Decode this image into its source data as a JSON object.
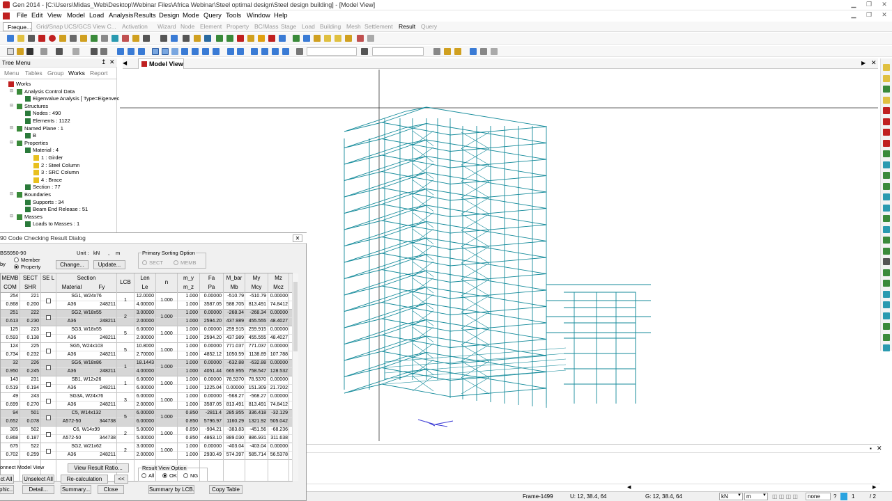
{
  "window": {
    "title": "Gen 2014 - [C:\\Users\\Midas_Web\\Desktop\\Webinar Files\\Africa Webinar\\Steel optimal design\\Steel design building] - [Model View]"
  },
  "menu": [
    "File",
    "Edit",
    "View",
    "Model",
    "Load",
    "Analysis",
    "Results",
    "Design",
    "Mode",
    "Query",
    "Tools",
    "Window",
    "Help"
  ],
  "ribbon": {
    "dropdown": "Freque...",
    "tabs": [
      {
        "label": "Grid/Snap",
        "active": false
      },
      {
        "label": "UCS/GCS",
        "active": false
      },
      {
        "label": "View C...",
        "active": false
      },
      {
        "label": "Activation",
        "active": false
      },
      {
        "label": "Wizard",
        "active": false
      },
      {
        "label": "Node",
        "active": false
      },
      {
        "label": "Element",
        "active": false
      },
      {
        "label": "Property",
        "active": false
      },
      {
        "label": "BC/Mass",
        "active": false
      },
      {
        "label": "Stage",
        "active": false
      },
      {
        "label": "Load",
        "active": false
      },
      {
        "label": "Building",
        "active": false
      },
      {
        "label": "Mesh",
        "active": false
      },
      {
        "label": "Settlement",
        "active": false
      },
      {
        "label": "Result",
        "active": true
      },
      {
        "label": "Query",
        "active": false
      }
    ]
  },
  "tree": {
    "title": "Tree Menu",
    "tabs": [
      "Menu",
      "Tables",
      "Group",
      "Works",
      "Report"
    ],
    "active_tab": "Works",
    "nodes": [
      {
        "label": "Works",
        "level": 0
      },
      {
        "label": "Analysis Control Data",
        "level": 1
      },
      {
        "label": "Eigenvalue Analysis [ Type=Eigenvec",
        "level": 2
      },
      {
        "label": "Structures",
        "level": 1
      },
      {
        "label": "Nodes : 490",
        "level": 2
      },
      {
        "label": "Elements : 1122",
        "level": 2
      },
      {
        "label": "Named Plane : 1",
        "level": 1
      },
      {
        "label": "B",
        "level": 2
      },
      {
        "label": "Properties",
        "level": 1
      },
      {
        "label": "Material : 4",
        "level": 2
      },
      {
        "label": "1 : Girder",
        "level": 3
      },
      {
        "label": "2 : Steel Column",
        "level": 3
      },
      {
        "label": "3 : SRC Column",
        "level": 3
      },
      {
        "label": "4 : Brace",
        "level": 3
      },
      {
        "label": "Section : 77",
        "level": 2
      },
      {
        "label": "Boundaries",
        "level": 1
      },
      {
        "label": "Supports : 34",
        "level": 2
      },
      {
        "label": "Beam End Release : 51",
        "level": 2
      },
      {
        "label": "Masses",
        "level": 1
      },
      {
        "label": "Loads to Masses : 1",
        "level": 2
      }
    ]
  },
  "model_view": {
    "tab_label": "Model View"
  },
  "dialog": {
    "title": "90 Code Checking Result Dialog",
    "code": "BS5950-90",
    "unit_label": "Unit :",
    "unit_force": "kN",
    "unit_sep": ",",
    "unit_length": "m",
    "sort_by_label": "by",
    "sort_member": "Member",
    "sort_property": "Property",
    "change_btn": "Change...",
    "update_btn": "Update...",
    "primary_sorting": {
      "title": "Primary Sorting Option",
      "sect": "SECT",
      "memb": "MEMB"
    },
    "headers_top": [
      "MEMB",
      "SECT",
      "SE L",
      "Section",
      "LCB",
      "Len",
      "n",
      "m_y",
      "Fa",
      "M_bar",
      "My",
      "Mz"
    ],
    "headers_bot": [
      "COM",
      "SHR",
      "",
      "Material",
      "Fy",
      "",
      "Le",
      "",
      "m_z",
      "Pa",
      "Mb",
      "Mcy",
      "Mcz"
    ],
    "rows": [
      {
        "memb": "254",
        "sect": "221",
        "section": "SG1, W24x76",
        "lcb": "1",
        "len": "12.0000",
        "n": "1.000",
        "my": "1.000",
        "fa": "0.00000",
        "mbar": "-510.79",
        "My": "-510.79",
        "Mz": "0.00000",
        "com": "0.868",
        "shr": "0.200",
        "mat": "A36",
        "fy": "248211",
        "le": "4.00000",
        "mz": "1.000",
        "pa": "3587.05",
        "mb": "588.705",
        "mcy": "813.491",
        "mcz": "74.8412",
        "shade": false
      },
      {
        "memb": "251",
        "sect": "222",
        "section": "SG2, W18x55",
        "lcb": "2",
        "len": "3.00000",
        "n": "1.000",
        "my": "1.000",
        "fa": "0.00000",
        "mbar": "-268.34",
        "My": "-268.34",
        "Mz": "0.00000",
        "com": "0.613",
        "shr": "0.230",
        "mat": "A36",
        "fy": "248211",
        "le": "2.00000",
        "mz": "1.000",
        "pa": "2594.20",
        "mb": "437.989",
        "mcy": "455.555",
        "mcz": "48.4027",
        "shade": true
      },
      {
        "memb": "125",
        "sect": "223",
        "section": "SG3, W18x55",
        "lcb": "5",
        "len": "6.00000",
        "n": "1.000",
        "my": "1.000",
        "fa": "0.00000",
        "mbar": "259.915",
        "My": "259.915",
        "Mz": "0.00000",
        "com": "0.593",
        "shr": "0.138",
        "mat": "A36",
        "fy": "248211",
        "le": "2.00000",
        "mz": "1.000",
        "pa": "2594.20",
        "mb": "437.989",
        "mcy": "455.555",
        "mcz": "48.4027",
        "shade": false
      },
      {
        "memb": "124",
        "sect": "225",
        "section": "SG5, W24x103",
        "lcb": "5",
        "len": "10.8000",
        "n": "1.000",
        "my": "1.000",
        "fa": "0.00000",
        "mbar": "771.037",
        "My": "771.037",
        "Mz": "0.00000",
        "com": "0.734",
        "shr": "0.232",
        "mat": "A36",
        "fy": "248211",
        "le": "2.70000",
        "mz": "1.000",
        "pa": "4852.12",
        "mb": "1050.59",
        "mcy": "1138.89",
        "mcz": "107.788",
        "shade": false
      },
      {
        "memb": "32",
        "sect": "226",
        "section": "SG6, W18x86",
        "lcb": "1",
        "len": "18.1443",
        "n": "1.000",
        "my": "1.000",
        "fa": "0.00000",
        "mbar": "-632.88",
        "My": "-632.88",
        "Mz": "0.00000",
        "com": "0.950",
        "shr": "0.245",
        "mat": "A36",
        "fy": "248211",
        "le": "4.00000",
        "mz": "1.000",
        "pa": "4051.44",
        "mb": "665.955",
        "mcy": "758.547",
        "mcz": "128.532",
        "shade": true
      },
      {
        "memb": "143",
        "sect": "231",
        "section": "SB1, W12x26",
        "lcb": "1",
        "len": "6.00000",
        "n": "1.000",
        "my": "1.000",
        "fa": "0.00000",
        "mbar": "78.5370",
        "My": "78.5370",
        "Mz": "0.00000",
        "com": "0.519",
        "shr": "0.194",
        "mat": "A36",
        "fy": "248211",
        "le": "6.00000",
        "mz": "1.000",
        "pa": "1225.04",
        "mb": "0.00000",
        "mcy": "151.309",
        "mcz": "21.7202",
        "shade": false
      },
      {
        "memb": "49",
        "sect": "243",
        "section": "SG3A, W24x76",
        "lcb": "3",
        "len": "6.00000",
        "n": "1.000",
        "my": "1.000",
        "fa": "0.00000",
        "mbar": "-568.27",
        "My": "-568.27",
        "Mz": "0.00000",
        "com": "0.699",
        "shr": "0.270",
        "mat": "A36",
        "fy": "248211",
        "le": "2.00000",
        "mz": "1.000",
        "pa": "3587.05",
        "mb": "813.491",
        "mcy": "813.491",
        "mcz": "74.8412",
        "shade": false
      },
      {
        "memb": "94",
        "sect": "501",
        "section": "C5, W14x132",
        "lcb": "5",
        "len": "6.00000",
        "n": "1.000",
        "my": "0.850",
        "fa": "-2811.4",
        "mbar": "285.955",
        "My": "336.418",
        "Mz": "-32.129",
        "com": "0.652",
        "shr": "0.078",
        "mat": "A572-50",
        "fy": "344738",
        "le": "6.00000",
        "mz": "0.850",
        "pa": "5796.97",
        "mb": "1160.29",
        "mcy": "1321.92",
        "mcz": "505.042",
        "shade": true
      },
      {
        "memb": "305",
        "sect": "502",
        "section": "C6, W14x99",
        "lcb": "2",
        "len": "5.00000",
        "n": "1.000",
        "my": "0.850",
        "fa": "-904.21",
        "mbar": "-383.83",
        "My": "-451.56",
        "Mz": "-68.236",
        "com": "0.868",
        "shr": "0.187",
        "mat": "A572-50",
        "fy": "344738",
        "le": "5.00000",
        "mz": "0.850",
        "pa": "4863.10",
        "mb": "889.030",
        "mcy": "886.931",
        "mcz": "311.638",
        "shade": false
      },
      {
        "memb": "675",
        "sect": "522",
        "section": "SG2, W21x62",
        "lcb": "2",
        "len": "3.00000",
        "n": "1.000",
        "my": "1.000",
        "fa": "0.00000",
        "mbar": "-403.04",
        "My": "-403.04",
        "Mz": "0.00000",
        "com": "0.702",
        "shr": "0.259",
        "mat": "A36",
        "fy": "248211",
        "le": "2.00000",
        "mz": "1.000",
        "pa": "2930.49",
        "mb": "574.397",
        "mcy": "585.714",
        "mcz": "56.5378",
        "shade": false
      }
    ],
    "connect_label": "onnect Model View",
    "view_ratio_btn": "View Result Ratio...",
    "result_view_option": {
      "title": "Result View Option",
      "all": "All",
      "ok": "OK",
      "ng": "NG"
    },
    "select_all_btn": "ct All",
    "unselect_all_btn": "Unselect All",
    "recalc_btn": "Re-calculation",
    "collapse_btn": "<<",
    "graphic_btn": "phic...",
    "detail_btn": "Detail...",
    "summary_btn": "Summary...",
    "close_btn": "Close",
    "summary_lcb_btn": "Summary by LCB...",
    "copy_table_btn": "Copy Table"
  },
  "status": {
    "frame": "Frame-1499",
    "u_coord": "U: 12, 38.4, 64",
    "g_coord": "G: 12, 38.4, 64",
    "force_unit": "kN",
    "length_unit": "m",
    "view_mode": "none",
    "page": "1",
    "page_total": "/ 2"
  },
  "colors": {
    "model": "#138a9a",
    "accent": "#c02020"
  }
}
